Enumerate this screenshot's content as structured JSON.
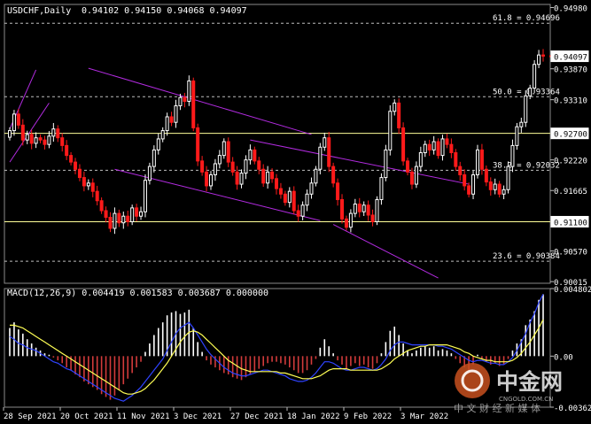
{
  "header": {
    "symbol": "USDCHF,Daily",
    "ohlc": "0.94102 0.94150 0.94068 0.94097"
  },
  "macd_header": "MACD(12,26,9) 0.004419 0.001583 0.003687 0.000000",
  "watermark": {
    "cn": "中金网",
    "en": "CNGOLD.COM.CN",
    "sub": "中 文 财 经 新 媒 体"
  },
  "colors": {
    "background": "#000000",
    "bull": "#ffffff",
    "bear": "#ff1a1a",
    "channel": "#b22be0",
    "fib_line": "#bdbdbd",
    "level_line": "#ffff99",
    "macd_bar_pos": "#ffffff",
    "macd_bar_neg": "#d23b3b",
    "macd_line": "#2f43ff",
    "signal_line": "#ffff55",
    "current_price": "#ff2222"
  },
  "chart_data": [
    {
      "type": "candlestick",
      "title": "USDCHF,Daily",
      "x_tick_labels": [
        "28 Sep 2021",
        "20 Oct 2021",
        "11 Nov 2021",
        "3 Dec 2021",
        "27 Dec 2021",
        "18 Jan 2022",
        "9 Feb 2022",
        "3 Mar 2022"
      ],
      "y_ticks": [
        "0.94980",
        "0.94090",
        "0.93870",
        "0.93310",
        "0.92220",
        "0.91665",
        "0.90570",
        "0.90015"
      ],
      "ylim": [
        0.89985,
        0.95036
      ],
      "last_price": "0.94097",
      "fib_levels": [
        {
          "label": "61.8 = 0.94696",
          "value": 0.94696
        },
        {
          "label": "50.0 = 0.93364",
          "value": 0.93364
        },
        {
          "label": "38.2 = 0.92032",
          "value": 0.92032
        },
        {
          "label": "23.6 = 0.90384",
          "value": 0.90384
        }
      ],
      "horizontal_levels": [
        {
          "label": "0.92700",
          "value": 0.927
        },
        {
          "label": "0.91100",
          "value": 0.911
        }
      ],
      "closes": [
        0.9275,
        0.9305,
        0.9285,
        0.9258,
        0.9268,
        0.9252,
        0.9262,
        0.9258,
        0.925,
        0.9265,
        0.9278,
        0.9262,
        0.9248,
        0.923,
        0.9218,
        0.9205,
        0.919,
        0.9175,
        0.918,
        0.9165,
        0.9148,
        0.913,
        0.9118,
        0.9098,
        0.9125,
        0.9108,
        0.912,
        0.911,
        0.9135,
        0.912,
        0.9128,
        0.9185,
        0.921,
        0.924,
        0.926,
        0.9275,
        0.93,
        0.929,
        0.932,
        0.9335,
        0.9328,
        0.9365,
        0.928,
        0.922,
        0.92,
        0.9175,
        0.9195,
        0.9215,
        0.923,
        0.9255,
        0.9218,
        0.92,
        0.9178,
        0.9198,
        0.9222,
        0.924,
        0.922,
        0.9205,
        0.918,
        0.92,
        0.9188,
        0.917,
        0.916,
        0.9145,
        0.9165,
        0.913,
        0.912,
        0.914,
        0.916,
        0.918,
        0.9205,
        0.9245,
        0.9262,
        0.921,
        0.918,
        0.915,
        0.9115,
        0.91,
        0.9125,
        0.9142,
        0.9128,
        0.914,
        0.9122,
        0.911,
        0.915,
        0.919,
        0.924,
        0.931,
        0.9325,
        0.928,
        0.922,
        0.92,
        0.9178,
        0.921,
        0.9235,
        0.925,
        0.924,
        0.9255,
        0.923,
        0.926,
        0.925,
        0.9235,
        0.921,
        0.9195,
        0.9175,
        0.916,
        0.9195,
        0.924,
        0.9205,
        0.9182,
        0.9168,
        0.9178,
        0.916,
        0.9168,
        0.921,
        0.9248,
        0.9282,
        0.929,
        0.9338,
        0.9352,
        0.9395,
        0.9412,
        0.941
      ],
      "current_x_index": 123
    },
    {
      "type": "macd",
      "title": "MACD(12,26,9) 0.004419 0.001583 0.003687 0.000000",
      "y_ticks": [
        "0.004802",
        "0.00",
        "-0.003628"
      ],
      "ylim": [
        -0.003628,
        0.004802
      ],
      "histogram": [
        0.002,
        0.0024,
        0.0019,
        0.0016,
        0.0012,
        0.0009,
        0.0006,
        0.0004,
        0.0002,
        0.0001,
        -0.0001,
        -0.0003,
        -0.0005,
        -0.0008,
        -0.001,
        -0.0013,
        -0.0015,
        -0.0018,
        -0.002,
        -0.0022,
        -0.0024,
        -0.0027,
        -0.0029,
        -0.0031,
        -0.0028,
        -0.0024,
        -0.002,
        -0.0016,
        -0.0012,
        -0.0008,
        -0.0004,
        0.0003,
        0.0009,
        0.0015,
        0.002,
        0.0024,
        0.0029,
        0.0031,
        0.0032,
        0.003,
        0.0031,
        0.0033,
        0.002,
        0.001,
        0.0003,
        -0.0003,
        -0.0006,
        -0.0008,
        -0.001,
        -0.0012,
        -0.0013,
        -0.0015,
        -0.0016,
        -0.0017,
        -0.0015,
        -0.0013,
        -0.0011,
        -0.0009,
        -0.0007,
        -0.0005,
        -0.0004,
        -0.0004,
        -0.0005,
        -0.0006,
        -0.0008,
        -0.001,
        -0.0012,
        -0.0012,
        -0.001,
        -0.0006,
        -0.0002,
        0.0006,
        0.0012,
        0.0007,
        0.0002,
        -0.0003,
        -0.0006,
        -0.0009,
        -0.0007,
        -0.0005,
        -0.0007,
        -0.0006,
        -0.0008,
        -0.0009,
        -0.0005,
        0.0002,
        0.001,
        0.0018,
        0.0021,
        0.0015,
        0.0009,
        0.0004,
        0.0002,
        0.0004,
        0.0006,
        0.0007,
        0.0006,
        0.0007,
        0.0004,
        0.0005,
        0.0004,
        0.0002,
        -0.0002,
        -0.0005,
        -0.0008,
        -0.001,
        -0.0006,
        0.0001,
        -0.0002,
        -0.0004,
        -0.0006,
        -0.0005,
        -0.0007,
        -0.0006,
        -0.0002,
        0.0004,
        0.0009,
        0.0012,
        0.0022,
        0.0026,
        0.0032,
        0.004,
        0.0044
      ],
      "macd_line": [
        0.0014,
        0.0012,
        0.0009,
        0.0008,
        0.0006,
        0.0005,
        0.0004,
        0.0002,
        0.0,
        -0.0002,
        -0.0004,
        -0.0005,
        -0.0007,
        -0.0009,
        -0.001,
        -0.0012,
        -0.0014,
        -0.0016,
        -0.0018,
        -0.002,
        -0.0022,
        -0.0024,
        -0.0026,
        -0.0028,
        -0.003,
        -0.0031,
        -0.0032,
        -0.003,
        -0.0028,
        -0.0025,
        -0.0022,
        -0.0018,
        -0.0014,
        -0.001,
        -0.0006,
        -0.0002,
        0.0004,
        0.001,
        0.0016,
        0.002,
        0.0022,
        0.0024,
        0.002,
        0.0015,
        0.001,
        0.0005,
        0.0001,
        -0.0002,
        -0.0005,
        -0.0008,
        -0.001,
        -0.0012,
        -0.0013,
        -0.0014,
        -0.0014,
        -0.0013,
        -0.0012,
        -0.0011,
        -0.001,
        -0.001,
        -0.0011,
        -0.0012,
        -0.0013,
        -0.0014,
        -0.0016,
        -0.0017,
        -0.0018,
        -0.0018,
        -0.0017,
        -0.0015,
        -0.0012,
        -0.0008,
        -0.0004,
        -0.0004,
        -0.0005,
        -0.0007,
        -0.0009,
        -0.001,
        -0.001,
        -0.0009,
        -0.0008,
        -0.0008,
        -0.0009,
        -0.001,
        -0.0009,
        -0.0006,
        -0.0002,
        0.0004,
        0.0008,
        0.001,
        0.001,
        0.0009,
        0.0008,
        0.0008,
        0.0008,
        0.0008,
        0.0008,
        0.0008,
        0.0007,
        0.0007,
        0.0006,
        0.0005,
        0.0003,
        0.0001,
        -0.0001,
        -0.0003,
        -0.0004,
        -0.0003,
        -0.0003,
        -0.0004,
        -0.0005,
        -0.0005,
        -0.0006,
        -0.0006,
        -0.0004,
        -0.0001,
        0.0004,
        0.001,
        0.0016,
        0.0024,
        0.003,
        0.0038,
        0.0044
      ],
      "signal_line": [
        0.0022,
        0.0022,
        0.0021,
        0.002,
        0.0018,
        0.0016,
        0.0014,
        0.0012,
        0.001,
        0.0008,
        0.0006,
        0.0004,
        0.0002,
        0.0,
        -0.0002,
        -0.0004,
        -0.0006,
        -0.0008,
        -0.001,
        -0.0012,
        -0.0014,
        -0.0016,
        -0.0018,
        -0.002,
        -0.0022,
        -0.0024,
        -0.0026,
        -0.0027,
        -0.0027,
        -0.0026,
        -0.0025,
        -0.0023,
        -0.002,
        -0.0017,
        -0.0013,
        -0.0009,
        -0.0005,
        0.0,
        0.0005,
        0.001,
        0.0014,
        0.0017,
        0.0018,
        0.0017,
        0.0015,
        0.0012,
        0.0009,
        0.0006,
        0.0003,
        0.0,
        -0.0003,
        -0.0005,
        -0.0007,
        -0.0009,
        -0.001,
        -0.0011,
        -0.0011,
        -0.0011,
        -0.0011,
        -0.0011,
        -0.0011,
        -0.0011,
        -0.0012,
        -0.0012,
        -0.0013,
        -0.0014,
        -0.0015,
        -0.0016,
        -0.0016,
        -0.0016,
        -0.0015,
        -0.0014,
        -0.0012,
        -0.001,
        -0.0009,
        -0.0009,
        -0.0009,
        -0.0009,
        -0.001,
        -0.001,
        -0.001,
        -0.001,
        -0.001,
        -0.001,
        -0.001,
        -0.0009,
        -0.0007,
        -0.0005,
        -0.0002,
        0.0,
        0.0002,
        0.0004,
        0.0005,
        0.0006,
        0.0007,
        0.0007,
        0.0008,
        0.0008,
        0.0008,
        0.0008,
        0.0008,
        0.0007,
        0.0006,
        0.0005,
        0.0003,
        0.0002,
        0.0,
        -0.0001,
        -0.0002,
        -0.0003,
        -0.0003,
        -0.0004,
        -0.0004,
        -0.0004,
        -0.0004,
        -0.0003,
        -0.0001,
        0.0002,
        0.0006,
        0.001,
        0.0015,
        0.002,
        0.0026
      ]
    }
  ]
}
